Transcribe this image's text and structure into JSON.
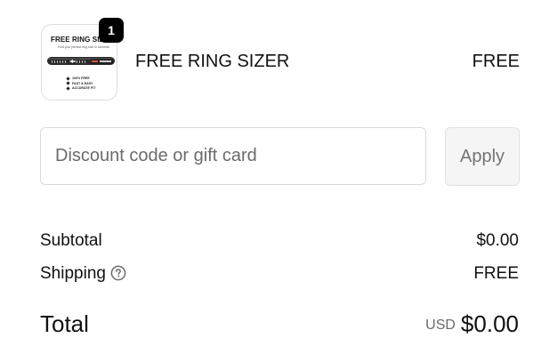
{
  "line_item": {
    "quantity": "1",
    "name": "FREE RING SIZER",
    "price": "FREE",
    "image": {
      "title": "FREE RING SIZER",
      "subtitle": "Find your perfect ring size in seconds",
      "band_text": "FREE RING SIZER",
      "features": [
        "100% FREE",
        "FAST & EASY",
        "ACCURATE FIT"
      ]
    }
  },
  "discount": {
    "placeholder": "Discount code or gift card",
    "value": "",
    "apply_label": "Apply"
  },
  "summary": {
    "subtotal_label": "Subtotal",
    "subtotal_value": "$0.00",
    "shipping_label": "Shipping",
    "shipping_value": "FREE",
    "total_label": "Total",
    "total_currency": "USD",
    "total_value": "$0.00"
  },
  "colors": {
    "text": "#111111",
    "muted": "#6b6b6b",
    "border": "#d9d9d9",
    "button_bg": "#f5f5f5",
    "badge_bg": "#000000"
  },
  "icons": {
    "shipping_help": "question-circle-icon"
  }
}
